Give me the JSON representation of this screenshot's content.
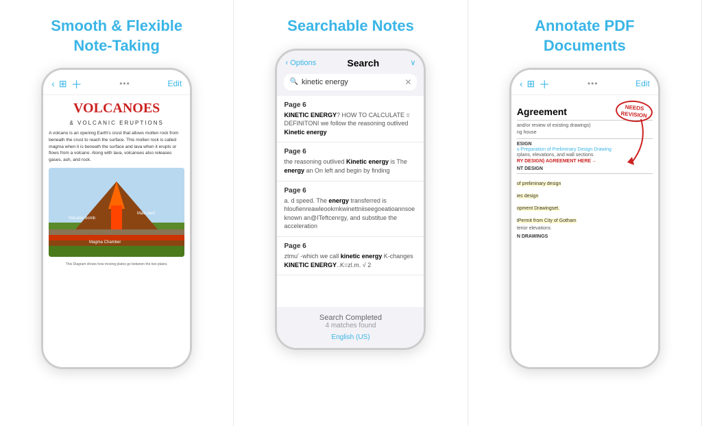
{
  "sections": [
    {
      "id": "note-taking",
      "title": "Smooth & Flexible\nNote-Taking",
      "phone": {
        "nav": {
          "back": "‹",
          "grid": "⊞",
          "plus": "+",
          "dots": "•••",
          "edit": "Edit"
        },
        "content": {
          "title": "VOLCANOES",
          "subtitle": "& Volcanic Eruptions",
          "body": "A volcano is an opening Earth's crust that allows molten rock from beneath the crust to reach the surface. This molten rock is called magma when it is beneath the surface and lava when it erupts or flows from a volcano. Along with lava, volcanoes also releases gases, ash, and rock.",
          "caption": "This Diagram shows how moving plates go between the two plates."
        }
      }
    },
    {
      "id": "searchable-notes",
      "title": "Searchable Notes",
      "phone": {
        "nav": {
          "options": "Options",
          "title": "Search",
          "chevron": "∨"
        },
        "search_query": "kinetic energy",
        "results": [
          {
            "page": "Page 6",
            "text": "KINETIC ENERGY? HOW TO CALCULATE = DEFINITONI we follow the reasoning outlived Kinetic energy"
          },
          {
            "page": "Page 6",
            "text": "the reasoning outlived Kinetic energy is The energy an On left and begin by finding"
          },
          {
            "page": "Page 6",
            "text": "a. d speed. The energy transferred is hloufienreawleookmkwinettniiseegoeatioannsoе known an@ITeftcenrgy, and substitue the acceleration"
          },
          {
            "page": "Page 6",
            "text": "ztmu' -which we call kinetic energy K-changes KINETIC ENERGY..K=zl.m. √ 2"
          }
        ],
        "footer": {
          "completed": "Search Completed",
          "matches": "4 matches found",
          "language": "English (US)"
        }
      }
    },
    {
      "id": "annotate-pdf",
      "title": "Annotate PDF\nDocuments",
      "phone": {
        "nav": {
          "back": "‹",
          "grid": "⊞",
          "plus": "+",
          "dots": "•••",
          "edit": "Edit"
        },
        "content": {
          "annotation": "NEEDS\nREVISION",
          "agreement_title": "Agreement",
          "rows": [
            {
              "type": "text",
              "text": "and/or review of existing drawings)"
            },
            {
              "type": "text",
              "text": "ng house"
            },
            {
              "type": "section",
              "text": "ESIGN"
            },
            {
              "type": "link",
              "text": "s-Preparation of Preliminary Design Drawing"
            },
            {
              "type": "text",
              "text": "rplans, elevations, and wall sections"
            },
            {
              "type": "annotation",
              "text": "RY DESIGN) AGREEMENT HERE"
            },
            {
              "type": "section",
              "text": "NT DESIGN"
            },
            {
              "type": "highlight",
              "text": "of preliminary design"
            },
            {
              "type": "highlight",
              "text": "ies design"
            },
            {
              "type": "highlight",
              "text": "opment Drawingset."
            },
            {
              "type": "highlight",
              "text": "tPermit from City of Gotham"
            },
            {
              "type": "text",
              "text": "terior elevations"
            },
            {
              "type": "section",
              "text": "N DRAWINGS"
            }
          ]
        }
      }
    }
  ]
}
